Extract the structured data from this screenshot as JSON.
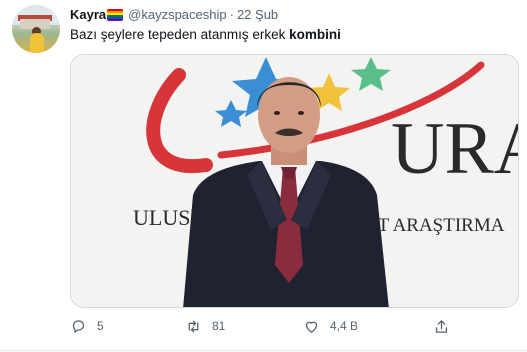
{
  "tweet": {
    "author_name": "Kayra",
    "handle": "@kayzspaceship",
    "separator": "·",
    "date": "22 Şub",
    "text_plain": "Bazı şeylere tepeden atanmış erkek ",
    "text_bold": "kombini",
    "media": {
      "logo_letters": "URA",
      "banner_text_left": "ULUSL",
      "banner_text_right": "ET ARAŞTIRMA"
    },
    "actions": {
      "reply_icon": "reply-icon",
      "reply_count": "5",
      "retweet_icon": "retweet-icon",
      "retweet_count": "81",
      "like_icon": "heart-icon",
      "like_count": "4,4 B",
      "share_icon": "share-icon"
    }
  },
  "colors": {
    "icon_gray": "#536471",
    "text_dark": "#0f1419",
    "pride_flag": [
      "#e40303",
      "#ff8c00",
      "#ffed00",
      "#008026",
      "#004dff",
      "#750787"
    ]
  }
}
